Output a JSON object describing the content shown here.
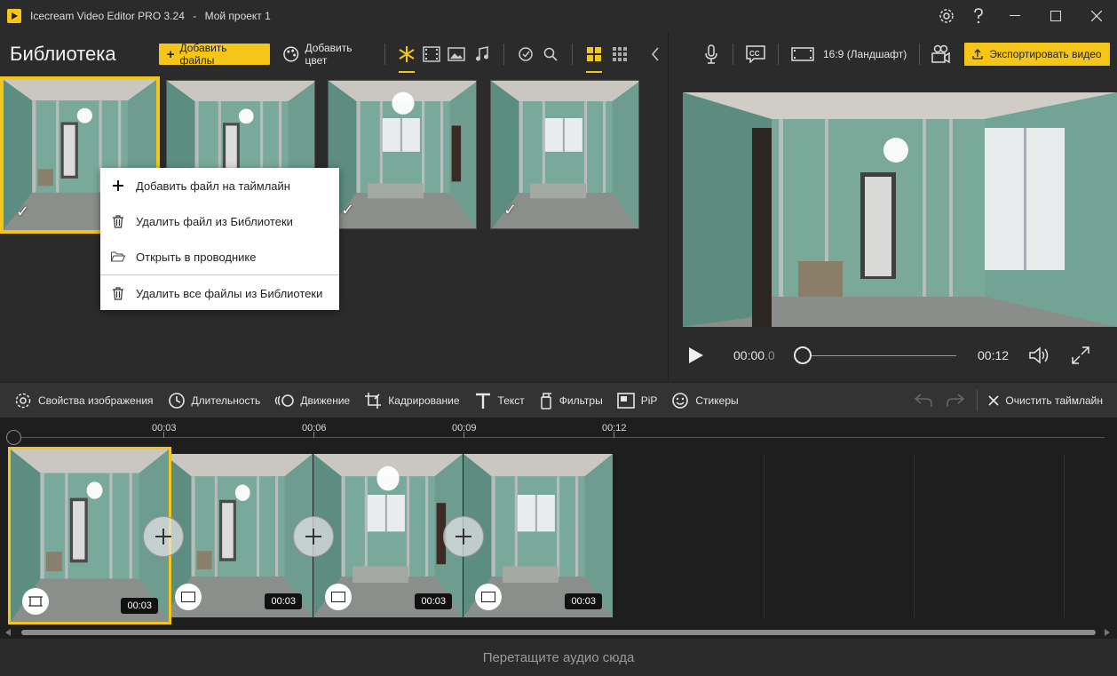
{
  "window": {
    "app_name": "Icecream Video Editor PRO 3.24",
    "separator": "-",
    "project_name": "Мой проект 1"
  },
  "library": {
    "title": "Библиотека",
    "add_files_label": "Добавить файлы",
    "add_color_label": "Добавить цвет"
  },
  "context_menu": {
    "items": [
      {
        "label": "Добавить файл на таймлайн",
        "icon": "plus-icon"
      },
      {
        "label": "Удалить файл из Библиотеки",
        "icon": "trash-icon"
      },
      {
        "label": "Открыть в проводнике",
        "icon": "folder-icon"
      },
      {
        "label": "Удалить все файлы из Библиотеки",
        "icon": "trash-icon"
      }
    ]
  },
  "preview": {
    "aspect_label": "16:9 (Ландшафт)",
    "export_label": "Экспортировать видео",
    "time_current_main": "00:00",
    "time_current_ms": ".0",
    "time_duration": "00:12"
  },
  "toolbar": {
    "image_props": "Свойства изображения",
    "duration": "Длительность",
    "motion": "Движение",
    "crop": "Кадрирование",
    "text": "Текст",
    "filters": "Фильтры",
    "pip": "PiP",
    "stickers": "Стикеры",
    "clear_timeline": "Очистить таймлайн"
  },
  "timeline": {
    "ticks": [
      "00:03",
      "00:06",
      "00:09",
      "00:12"
    ],
    "clips": [
      {
        "duration": "00:03"
      },
      {
        "duration": "00:03"
      },
      {
        "duration": "00:03"
      },
      {
        "duration": "00:03"
      }
    ],
    "audio_drop_label": "Перетащите аудио сюда"
  },
  "colors": {
    "accent": "#f5c518",
    "background": "#2b2b2b",
    "timeline_bg": "#1e1e1e",
    "wall_green": "#6fa394"
  }
}
